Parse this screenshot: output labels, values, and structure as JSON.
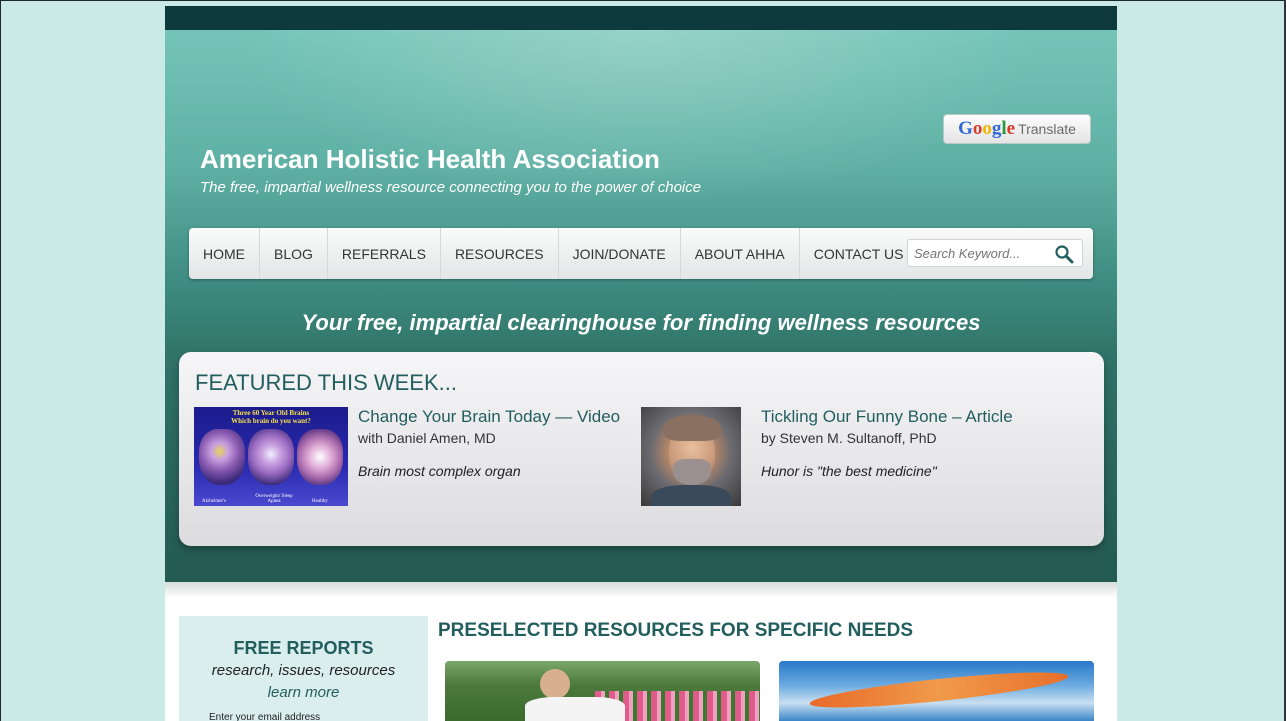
{
  "brand": {
    "title": "American Holistic Health Association",
    "tagline": "The free, impartial wellness resource connecting you to the power of choice",
    "google_translate_logo": "Google",
    "google_translate_text": "Translate"
  },
  "nav": {
    "items": [
      "HOME",
      "BLOG",
      "REFERRALS",
      "RESOURCES",
      "JOIN/DONATE",
      "ABOUT AHHA",
      "CONTACT US"
    ],
    "search_placeholder": "Search Keyword..."
  },
  "slogan": "Your free, impartial clearinghouse for finding wellness resources",
  "featured": {
    "heading": "FEATURED THIS WEEK...",
    "articles": [
      {
        "title": "Change Your Brain Today — Video",
        "byline": "with Daniel Amen, MD",
        "description": "Brain most complex organ",
        "image_caption_1": "Three 60 Year Old Brains",
        "image_caption_2": "Which brain do you want?",
        "image_labels": [
          "Alzheimer's",
          "Overweight/ Sleep Apnea",
          "Healthy"
        ]
      },
      {
        "title": "Tickling Our Funny Bone – Article",
        "byline": "by Steven M. Sultanoff, PhD",
        "description": "Hunor is \"the best medicine\""
      }
    ]
  },
  "reports": {
    "heading": "FREE REPORTS",
    "subheading": "research, issues, resources",
    "link": "learn more",
    "email_label": "Enter your email address"
  },
  "preselected": {
    "heading": "PRESELECTED RESOURCES FOR SPECIFIC NEEDS"
  },
  "colors": {
    "accent": "#235e5e",
    "topbar": "#0e3a3d",
    "header_top": "#74c4b8",
    "header_bottom": "#235a52",
    "page_bg": "#cbe9e6"
  }
}
